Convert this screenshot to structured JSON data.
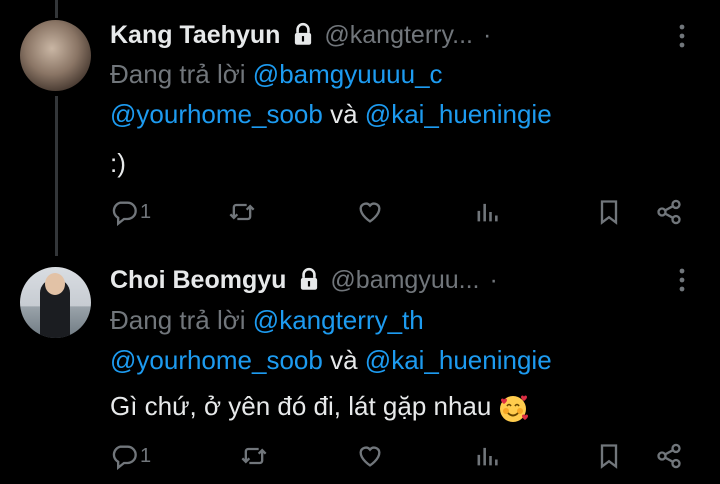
{
  "tweets": [
    {
      "name": "Kang Taehyun",
      "handle": "@kangterry...",
      "separator": "·",
      "replying_prefix": "Đang trả lời",
      "replying_first": "@bamgyuuuu_c",
      "mention2": "@yourhome_soob",
      "conj": "và",
      "mention3": "@kai_hueningie",
      "text": ":)",
      "reply_count": "1"
    },
    {
      "name": "Choi Beomgyu",
      "handle": "@bamgyuu...",
      "separator": "·",
      "replying_prefix": "Đang trả lời",
      "replying_first": "@kangterry_th",
      "mention2": "@yourhome_soob",
      "conj": "và",
      "mention3": "@kai_hueningie",
      "text": "Gì chứ, ở yên đó đi, lát gặp nhau",
      "emoji": "smiling-face-with-hearts",
      "reply_count": "1"
    }
  ],
  "icons": [
    "lock-icon",
    "more-icon",
    "reply-icon",
    "retweet-icon",
    "like-icon",
    "views-icon",
    "bookmark-icon",
    "share-icon"
  ],
  "colors": {
    "background": "#000000",
    "text": "#e7e9ea",
    "muted": "#71767b",
    "link": "#1d9bf0"
  }
}
